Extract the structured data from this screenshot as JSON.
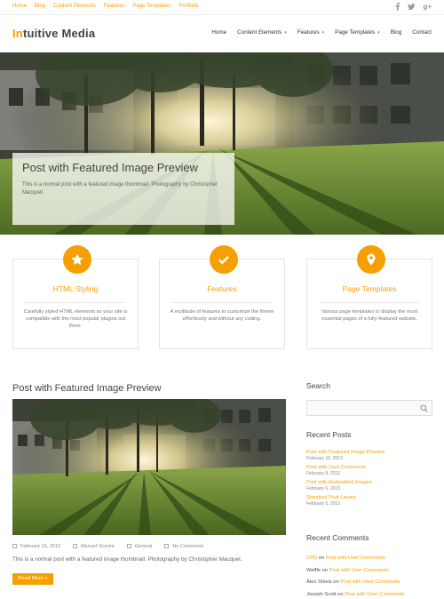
{
  "top_nav": [
    "Home",
    "Blog",
    "Content Elements",
    "Features",
    "Page Templates",
    "Portfolio"
  ],
  "social_icons": [
    "facebook-icon",
    "twitter-icon",
    "google-plus-icon"
  ],
  "logo": {
    "accent": "In",
    "rest": "tuitive Media"
  },
  "main_nav": [
    {
      "label": "Home",
      "dropdown": false
    },
    {
      "label": "Content Elements",
      "dropdown": true
    },
    {
      "label": "Features",
      "dropdown": true
    },
    {
      "label": "Page Templates",
      "dropdown": true
    },
    {
      "label": "Blog",
      "dropdown": false
    },
    {
      "label": "Contact",
      "dropdown": false
    }
  ],
  "hero": {
    "title": "Post with Featured Image Preview",
    "text": "This is a normal post with a featured image thumbnail. Photography by Christopher Macquet."
  },
  "features": [
    {
      "icon": "star-icon",
      "title": "HTML Styling",
      "desc": "Carefully styled HTML elements so your site is compatible with the most popular plugins out there."
    },
    {
      "icon": "checkmark-icon",
      "title": "Features",
      "desc": "A multitude of features to customize the theme effortlessly and without any coding."
    },
    {
      "icon": "map-pin-icon",
      "title": "Page Templates",
      "desc": "Various page templates to display the most essential pages of a fully-featured website."
    }
  ],
  "post": {
    "title": "Post with Featured Image Preview",
    "meta": [
      "February 16, 2013",
      "Manuel Vicente",
      "General",
      "No Comments"
    ],
    "excerpt": "This is a normal post with a featured image thumbnail. Photography by Christopher Macquet.",
    "read_more": "Read More »"
  },
  "sidebar": {
    "search_heading": "Search",
    "recent_posts_heading": "Recent Posts",
    "recent_posts": [
      {
        "title": "Post with Featured Image Preview",
        "date": "February 16, 2013"
      },
      {
        "title": "Post with User Comments",
        "date": "February 8, 2013"
      },
      {
        "title": "Post with Embedded Images",
        "date": "February 6, 2013"
      },
      {
        "title": "Standard Post Layout",
        "date": "February 5, 2013"
      }
    ],
    "recent_comments_heading": "Recent Comments",
    "recent_comments": [
      {
        "author": "CPD",
        "on": " on ",
        "post": "Post with User Comments"
      },
      {
        "author": "Waffle",
        "on": " on ",
        "post": "Post with User Comments"
      },
      {
        "author": "Alex Shiels",
        "on": " on ",
        "post": "Post with User Comments"
      },
      {
        "author": "Joseph Scott",
        "on": " on ",
        "post": "Post with User Comments"
      }
    ]
  },
  "colors": {
    "accent": "#f5a000",
    "text": "#555555",
    "heading": "#444444"
  }
}
